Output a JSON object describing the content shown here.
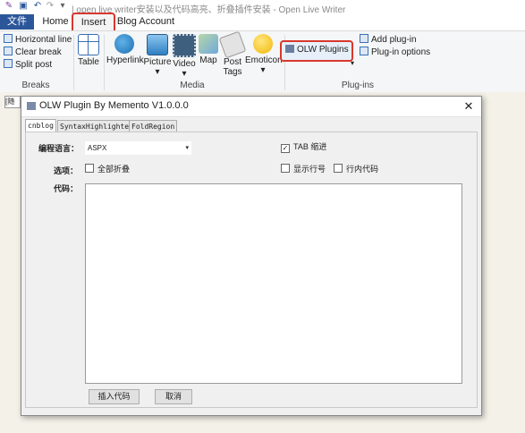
{
  "window": {
    "title": "| open live writer安装以及代码高亮、折叠插件安装 - Open Live Writer"
  },
  "tabs": [
    "文件",
    "Home",
    "Insert",
    "Blog Account"
  ],
  "ribbon": {
    "breaks": {
      "label": "Breaks",
      "items": [
        "Horizontal line",
        "Clear break",
        "Split post"
      ]
    },
    "table": {
      "label": "Table"
    },
    "media": {
      "label": "Media",
      "items": [
        "Hyperlink",
        "Picture",
        "Video",
        "Map",
        "Post Tags",
        "Emoticon"
      ]
    },
    "plugins": {
      "label": "Plug-ins",
      "olw_plugins": "OLW Plugins",
      "add_plugin": "Add plug-in",
      "plugin_options": "Plug-in options"
    }
  },
  "editor": {
    "tag_text": "[随笔"
  },
  "dialog": {
    "title": "OLW Plugin By Memento V1.0.0.0",
    "close": "✕",
    "tabs": [
      "cnblog",
      "SyntaxHighlighter",
      "FoldRegion"
    ],
    "language_label": "编程语言：",
    "language_value": "ASPX",
    "tab_indent_label": "TAB 缩进",
    "tab_indent_checked": true,
    "options_label": "选项：",
    "fold_all_label": "全部折叠",
    "fold_all_checked": false,
    "show_line_numbers_label": "显示行号",
    "show_line_numbers_checked": false,
    "inline_code_label": "行内代码",
    "inline_code_checked": false,
    "code_label": "代码：",
    "insert_button": "插入代码",
    "cancel_button": "取消"
  },
  "colors": {
    "file_tab": "#2b579a",
    "highlight": "#d9372d"
  }
}
